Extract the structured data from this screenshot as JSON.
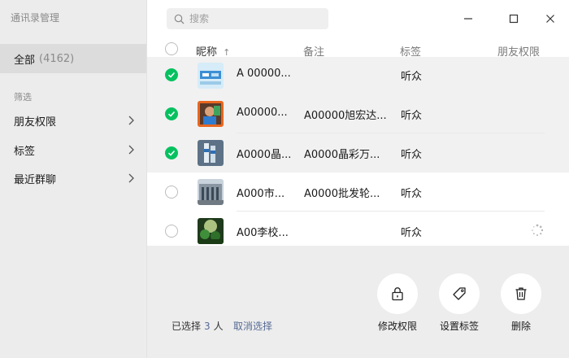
{
  "app": {
    "title": "通讯录管理"
  },
  "sidebar": {
    "all": {
      "label": "全部",
      "count": "(4162)"
    },
    "filter_title": "筛选",
    "items": [
      {
        "label": "朋友权限"
      },
      {
        "label": "标签"
      },
      {
        "label": "最近群聊"
      }
    ]
  },
  "search": {
    "placeholder": "搜索"
  },
  "table": {
    "headers": {
      "nickname": "昵称",
      "sort_indicator": "↑",
      "remark": "备注",
      "tag": "标签",
      "permission": "朋友权限"
    },
    "rows": [
      {
        "name": "A  00000...",
        "remark": "",
        "tag": "听众",
        "selected": true
      },
      {
        "name": "A00000...",
        "remark": "A00000旭宏达...",
        "tag": "听众",
        "selected": true
      },
      {
        "name": "A0000晶...",
        "remark": "A0000晶彩万...",
        "tag": "听众",
        "selected": true
      },
      {
        "name": "A000市...",
        "remark": "A0000批发轮...",
        "tag": "听众",
        "selected": false
      },
      {
        "name": "A00李校...",
        "remark": "",
        "tag": "听众",
        "selected": false
      }
    ]
  },
  "footer": {
    "selected_prefix": "已选择",
    "selected_count": "3",
    "selected_suffix": "人",
    "cancel_label": "取消选择",
    "actions": [
      {
        "label": "修改权限"
      },
      {
        "label": "设置标签"
      },
      {
        "label": "删除"
      }
    ]
  },
  "colors": {
    "accent": "#07c160",
    "link": "#576b95"
  }
}
